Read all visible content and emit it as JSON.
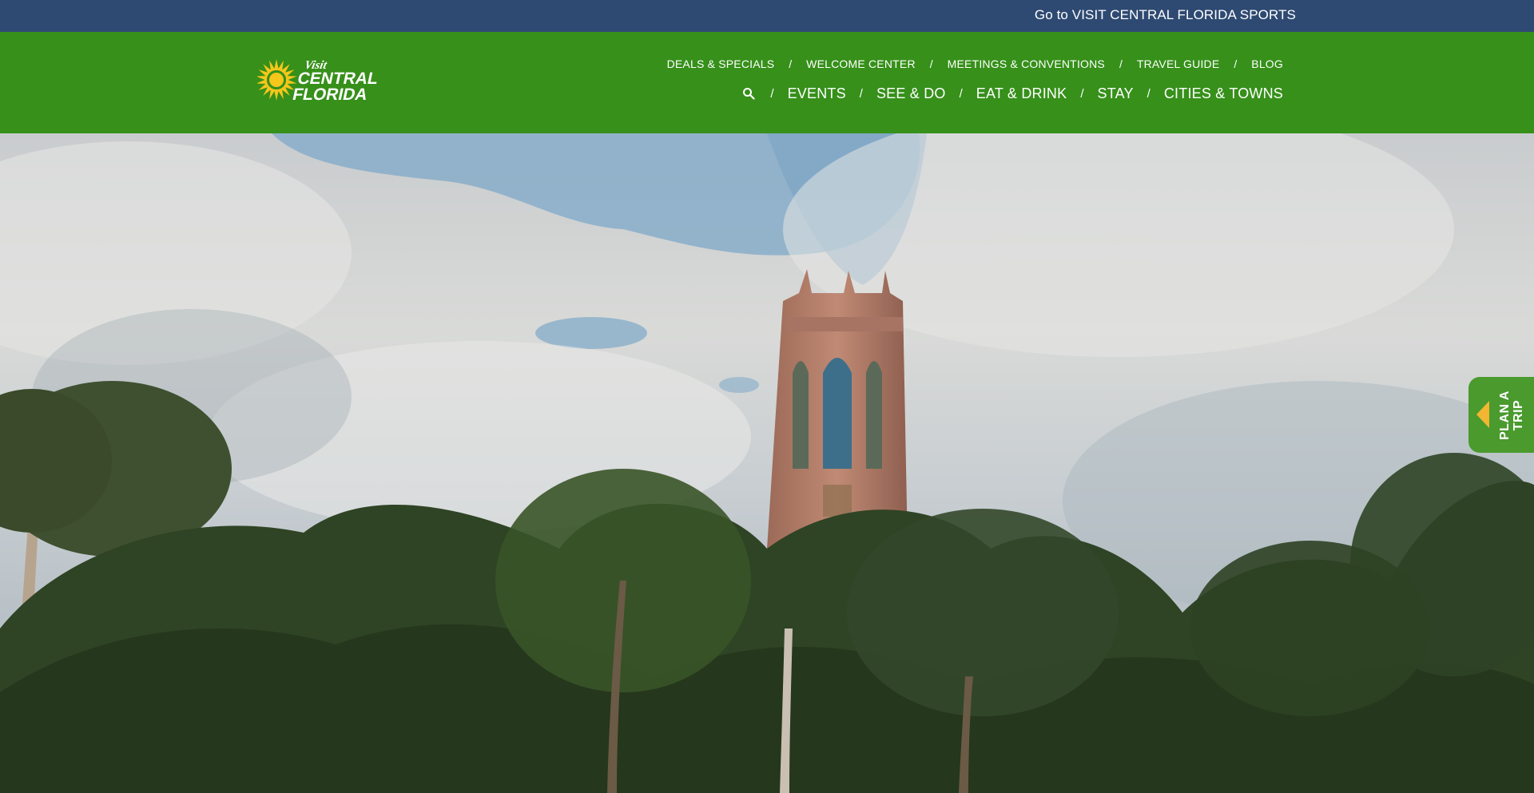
{
  "topbar": {
    "sports_link": "Go to VISIT CENTRAL FLORIDA SPORTS"
  },
  "logo": {
    "line1": "Visit",
    "line2": "CENTRAL",
    "line3": "FLORIDA"
  },
  "secondary_nav": {
    "items": [
      {
        "label": "DEALS & SPECIALS"
      },
      {
        "label": "WELCOME CENTER"
      },
      {
        "label": "MEETINGS & CONVENTIONS"
      },
      {
        "label": "TRAVEL GUIDE"
      },
      {
        "label": "BLOG"
      }
    ],
    "separator": "/"
  },
  "primary_nav": {
    "search_icon": "search-icon",
    "items": [
      {
        "label": "EVENTS"
      },
      {
        "label": "SEE & DO"
      },
      {
        "label": "EAT & DRINK"
      },
      {
        "label": "STAY"
      },
      {
        "label": "CITIES & TOWNS"
      }
    ],
    "separator": "/"
  },
  "plan_trip": {
    "label": "PLAN A\nTRIP",
    "arrow_icon": "caret-left-icon"
  },
  "colors": {
    "topbar": "#2e4a72",
    "header": "#36901a",
    "plan_trip_bg": "#4a9a2e",
    "accent_yellow": "#f2b632"
  }
}
